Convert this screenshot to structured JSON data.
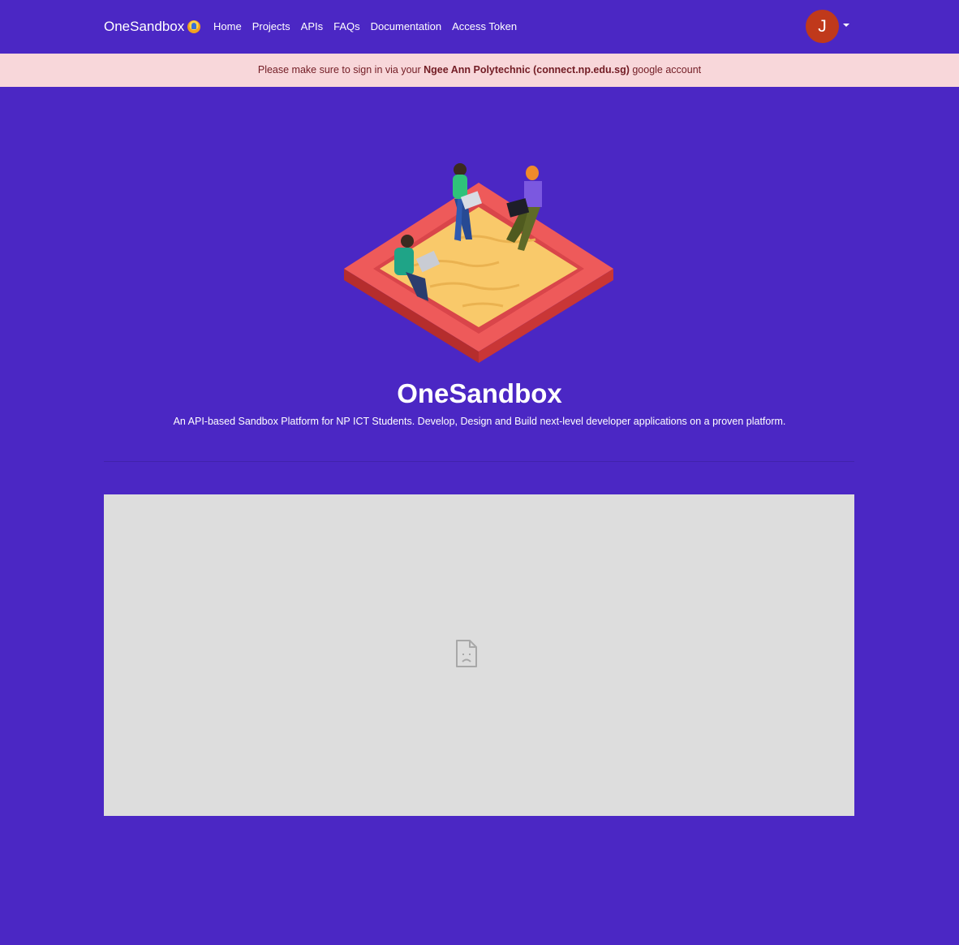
{
  "navbar": {
    "brand": "OneSandbox",
    "links": [
      "Home",
      "Projects",
      "APIs",
      "FAQs",
      "Documentation",
      "Access Token"
    ],
    "avatar_initial": "J"
  },
  "alert": {
    "prefix": "Please make sure to sign in via your ",
    "strong": "Ngee Ann Polytechnic (connect.np.edu.sg)",
    "suffix": " google account"
  },
  "hero": {
    "title": "OneSandbox",
    "subtitle": "An API-based Sandbox Platform for NP ICT Students. Develop, Design and Build next-level developer applications on a proven platform."
  },
  "embed": {
    "icon": "broken-page-icon"
  },
  "colors": {
    "background": "#4b27c4",
    "alert_bg": "#f8d7da",
    "alert_text": "#721c24",
    "avatar": "#c0391b",
    "embed_bg": "#dddddd"
  }
}
